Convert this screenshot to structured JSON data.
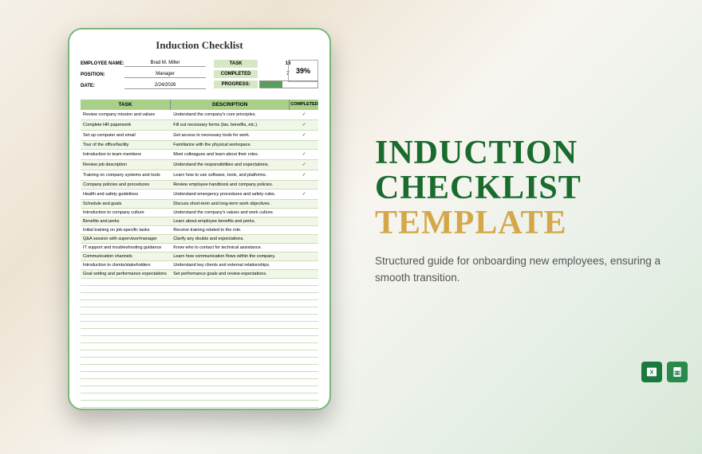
{
  "doc_title": "Induction Checklist",
  "fields": {
    "emp_lbl": "EMPLOYEE NAME:",
    "emp_val": "Brad M. Miller",
    "pos_lbl": "POSITION:",
    "pos_val": "Manager",
    "date_lbl": "DATE:",
    "date_val": "2/24/2026"
  },
  "stats": {
    "task_lbl": "TASK",
    "task_val": "18",
    "comp_lbl": "COMPLETED",
    "comp_val": "7",
    "pct": "39%",
    "prog_lbl": "PROGRESS:",
    "prog_pct": 39
  },
  "cols": {
    "task": "TASK",
    "desc": "DESCRIPTION",
    "comp": "COMPLETED"
  },
  "rows": [
    {
      "t": "Review company mission and values",
      "d": "Understand the company's core principles.",
      "c": "✓"
    },
    {
      "t": "Complete HR paperwork",
      "d": "Fill out necessary forms (tax, benefits, etc.).",
      "c": "✓"
    },
    {
      "t": "Set up computer and email",
      "d": "Get access to necessary tools for work.",
      "c": "✓"
    },
    {
      "t": "Tour of the office/facility",
      "d": "Familiarize with the physical workspace.",
      "c": ""
    },
    {
      "t": "Introduction to team members",
      "d": "Meet colleagues and learn about their roles.",
      "c": "✓"
    },
    {
      "t": "Review job description",
      "d": "Understand the responsibilities and expectations.",
      "c": "✓"
    },
    {
      "t": "Training on company systems and tools",
      "d": "Learn how to use software, tools, and platforms.",
      "c": "✓"
    },
    {
      "t": "Company policies and procedures",
      "d": "Review employee handbook and company policies.",
      "c": ""
    },
    {
      "t": "Health and safety guidelines",
      "d": "Understand emergency procedures and safety rules.",
      "c": "✓"
    },
    {
      "t": "Schedule and goals",
      "d": "Discuss short-term and long-term work objectives.",
      "c": ""
    },
    {
      "t": "Introduction to company culture",
      "d": "Understand the company's values and work culture.",
      "c": ""
    },
    {
      "t": "Benefits and perks",
      "d": "Learn about employee benefits and perks.",
      "c": ""
    },
    {
      "t": "Initial training on job-specific tasks",
      "d": "Receive training related to the role.",
      "c": ""
    },
    {
      "t": "Q&A session with supervisor/manager",
      "d": "Clarify any doubts and expectations.",
      "c": ""
    },
    {
      "t": "IT support and troubleshooting guidance",
      "d": "Know who to contact for technical assistance.",
      "c": ""
    },
    {
      "t": "Communication channels",
      "d": "Learn how communication flows within the company.",
      "c": ""
    },
    {
      "t": "Introduction to clients/stakeholders",
      "d": "Understand key clients and external relationships.",
      "c": ""
    },
    {
      "t": "Goal setting and performance expectations",
      "d": "Set performance goals and review expectations.",
      "c": ""
    }
  ],
  "promo": {
    "l1": "INDUCTION",
    "l2": "CHECKLIST",
    "l3": "TEMPLATE",
    "sub": "Structured guide for onboarding new employees, ensuring a smooth transition."
  },
  "icons": {
    "excel": "excel-icon",
    "sheets": "sheets-icon"
  }
}
